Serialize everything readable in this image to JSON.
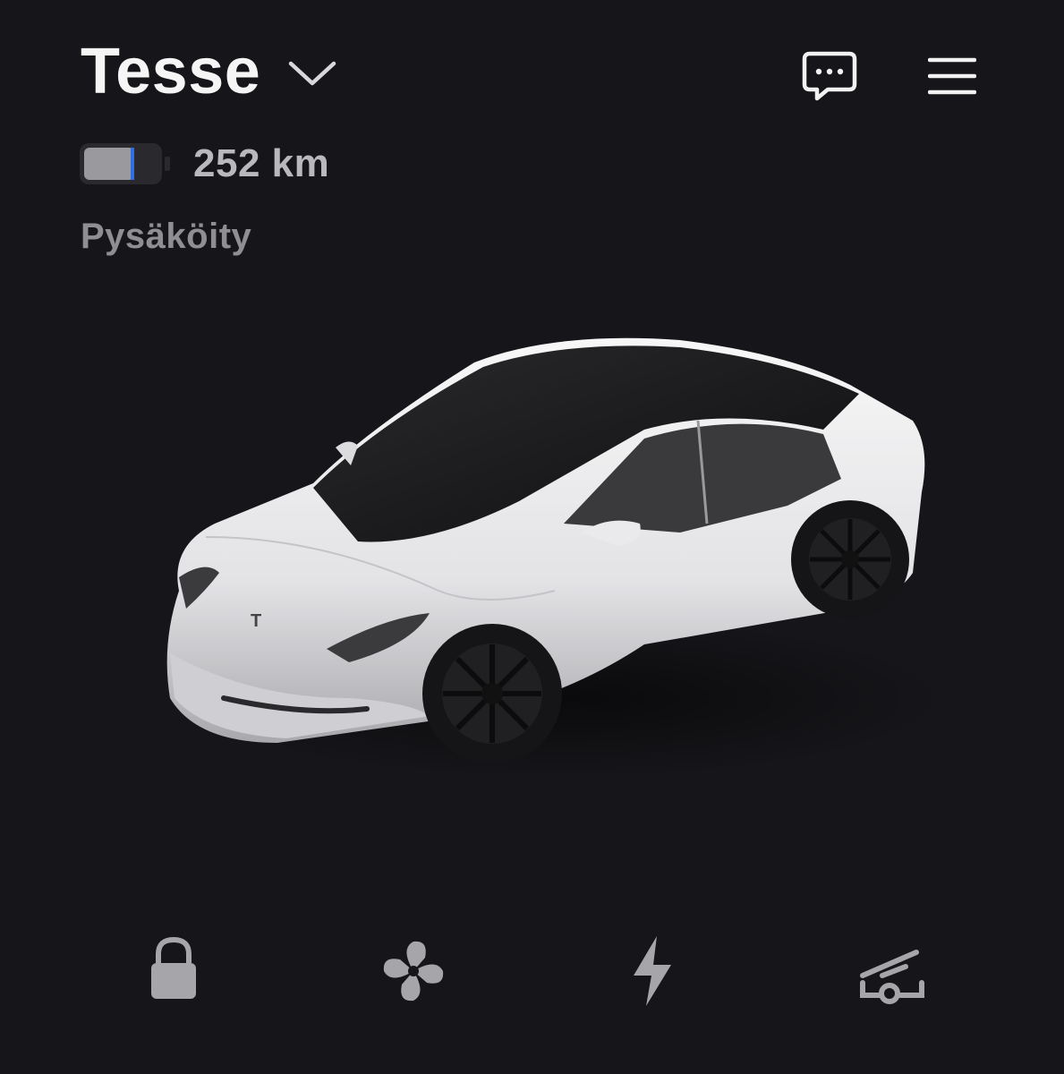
{
  "header": {
    "car_name": "Tesse"
  },
  "battery": {
    "range": "252 km"
  },
  "status": {
    "text": "Pysäköity"
  },
  "icons": {
    "vehicle_selector": "chevron-down-icon",
    "messages": "chat-bubble-icon",
    "menu": "hamburger-menu-icon",
    "lock": "lock-icon",
    "climate": "fan-icon",
    "charging": "lightning-bolt-icon",
    "trunk": "frunk-open-icon"
  },
  "colors": {
    "background": "#16161a",
    "primary_text": "#f5f5f5",
    "secondary_text": "#8e8e93",
    "battery_accent": "#2f6fe0",
    "icon_gray": "#a5a5aa"
  }
}
